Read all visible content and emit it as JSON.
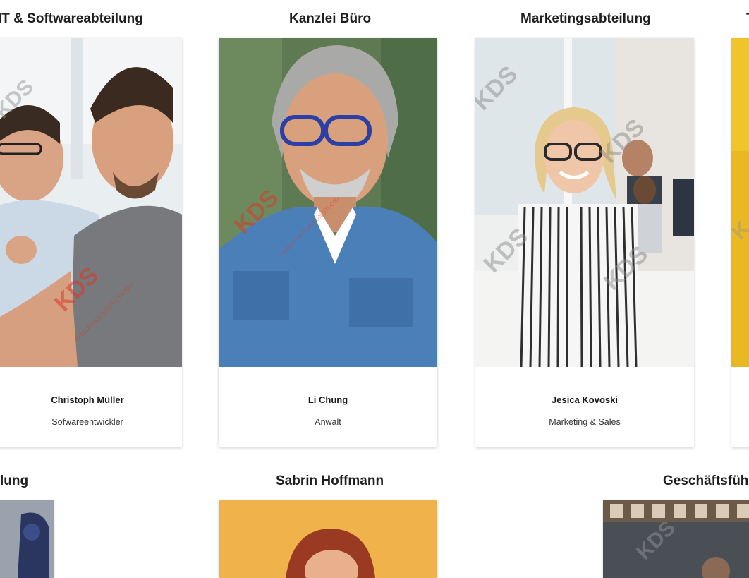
{
  "row1": {
    "headings": [
      "IT & Softwareabteilung",
      "Kanzlei Büro",
      "Marketingsabteilung",
      "T"
    ],
    "cards": [
      {
        "name": "Christoph Müller",
        "role": "Sofwareentwickler"
      },
      {
        "name": "Li Chung",
        "role": "Anwalt"
      },
      {
        "name": "Jesica Kovoski",
        "role": "Marketing & Sales"
      }
    ]
  },
  "row2": {
    "headings": [
      "lung",
      "Sabrin Hoffmann",
      "Geschäftsführ"
    ]
  },
  "watermark": {
    "logo": "KDS",
    "text": "©KREATIVES DESIGN STUDIO"
  },
  "colors": {
    "background": "#ffffff",
    "heading": "#1f1f1f",
    "watermark_red": "#d9382a",
    "watermark_gray": "#8c8c8c"
  }
}
